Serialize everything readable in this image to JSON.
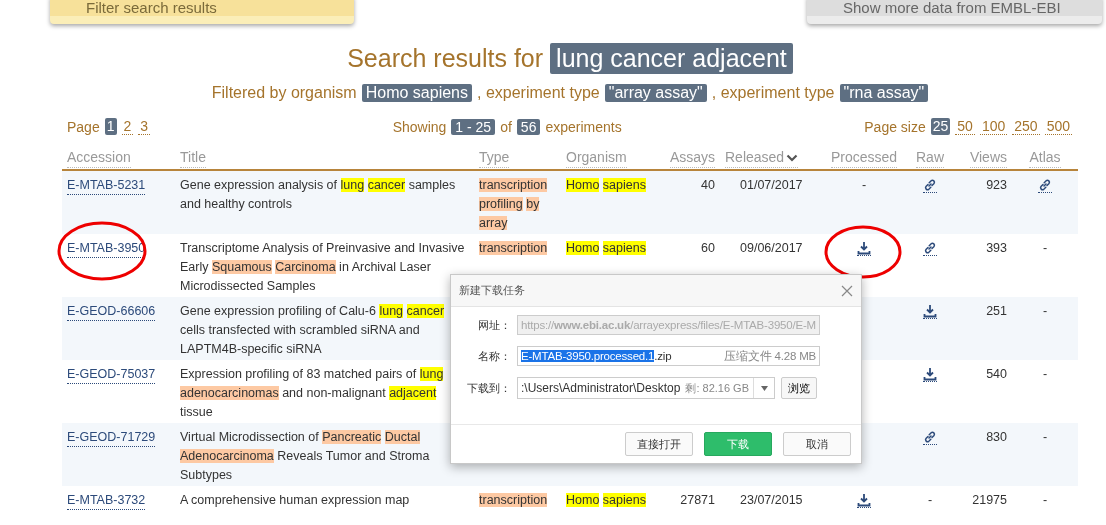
{
  "top_panels": [
    {
      "kind": "filter",
      "label": "Filter search results"
    },
    {
      "kind": "more",
      "label": "Show more data from EMBL-EBI"
    }
  ],
  "heading": {
    "prefix": "Search results for",
    "query": "lung cancer adjacent"
  },
  "filter_line": [
    {
      "text": "Filtered by organism",
      "tag": false
    },
    {
      "text": "Homo sapiens",
      "tag": true
    },
    {
      "text": ", experiment type",
      "tag": false
    },
    {
      "text": "\"array assay\"",
      "tag": true
    },
    {
      "text": ", experiment type",
      "tag": false
    },
    {
      "text": "\"rna assay\"",
      "tag": true
    }
  ],
  "pager": {
    "label": "Page",
    "pages": [
      {
        "label": "1",
        "selected": true
      },
      {
        "label": "2",
        "selected": false
      },
      {
        "label": "3",
        "selected": false
      }
    ]
  },
  "showing": [
    {
      "text": "Showing",
      "tag": false
    },
    {
      "text": "1 - 25",
      "tag": true
    },
    {
      "text": "of",
      "tag": false
    },
    {
      "text": "56",
      "tag": true
    },
    {
      "text": "experiments",
      "tag": false
    }
  ],
  "page_size": {
    "label": "Page size",
    "options": [
      {
        "label": "25",
        "selected": true
      },
      {
        "label": "50",
        "selected": false
      },
      {
        "label": "100",
        "selected": false
      },
      {
        "label": "250",
        "selected": false
      },
      {
        "label": "500",
        "selected": false
      }
    ]
  },
  "table": {
    "columns": [
      {
        "label": "Accession",
        "sorted": false
      },
      {
        "label": "Title",
        "sorted": false
      },
      {
        "label": "Type",
        "sorted": false
      },
      {
        "label": "Organism",
        "sorted": false
      },
      {
        "label": "Assays",
        "sorted": false
      },
      {
        "label": "Released",
        "sorted": true
      },
      {
        "label": "Processed",
        "sorted": false
      },
      {
        "label": "Raw",
        "sorted": false
      },
      {
        "label": "Views",
        "sorted": false
      },
      {
        "label": "Atlas",
        "sorted": false
      }
    ],
    "rows": [
      {
        "accession": "E-MTAB-5231",
        "title": [
          {
            "text": "Gene expression analysis of "
          },
          {
            "text": "lung cancer",
            "color": "#ffff00"
          },
          {
            "text": " samples and healthy controls"
          }
        ],
        "type": [
          {
            "text": "transcription profiling by array",
            "color": "#fdc9a3"
          }
        ],
        "organism": [
          {
            "text": "Homo sapiens",
            "color": "#ffff00"
          }
        ],
        "assays": "40",
        "released": "01/07/2017",
        "processed": {
          "kind": "dash",
          "text": "-"
        },
        "raw": {
          "kind": "link"
        },
        "views": "923",
        "atlas": {
          "kind": "link"
        }
      },
      {
        "accession": "E-MTAB-3950",
        "circled": true,
        "title": [
          {
            "text": "Transcriptome Analysis of Preinvasive and Invasive Early "
          },
          {
            "text": "Squamous Carcinoma",
            "color": "#fdc9a3"
          },
          {
            "text": " in Archival Laser Microdissected Samples"
          }
        ],
        "type": [
          {
            "text": "transcription",
            "color": "#fdc9a3"
          }
        ],
        "organism": [
          {
            "text": "Homo sapiens",
            "color": "#ffff00"
          }
        ],
        "assays": "60",
        "released": "09/06/2017",
        "processed": {
          "kind": "download",
          "circled": true
        },
        "raw": {
          "kind": "link"
        },
        "views": "393",
        "atlas": {
          "kind": "dash",
          "text": "-"
        }
      },
      {
        "accession": "E-GEOD-66606",
        "title": [
          {
            "text": "Gene expression profiling of Calu-6 "
          },
          {
            "text": "lung cancer",
            "color": "#ffff00"
          },
          {
            "text": " cells transfected with scrambled siRNA and LAPTM4B-specific siRNA"
          }
        ],
        "raw": {
          "kind": "download"
        },
        "views": "251",
        "atlas": {
          "kind": "dash",
          "text": "-"
        }
      },
      {
        "accession": "E-GEOD-75037",
        "title": [
          {
            "text": "Expression profiling of 83 matched pairs of "
          },
          {
            "text": "lung",
            "color": "#ffff00"
          },
          {
            "text": "adenocarcinomas",
            "color": "#fdc9a3"
          },
          {
            "text": " and non-malignant "
          },
          {
            "text": "adjacent",
            "color": "#ffff00"
          },
          {
            "text": " tissue"
          }
        ],
        "raw": {
          "kind": "download"
        },
        "views": "540",
        "atlas": {
          "kind": "dash",
          "text": "-"
        }
      },
      {
        "accession": "E-GEOD-71729",
        "title": [
          {
            "text": "Virtual Microdissection of "
          },
          {
            "text": "Pancreatic Ductal Adenocarcinoma",
            "color": "#fdc9a3"
          },
          {
            "text": " Reveals Tumor and Stroma Subtypes"
          }
        ],
        "raw": {
          "kind": "link"
        },
        "views": "830",
        "atlas": {
          "kind": "dash",
          "text": "-"
        }
      },
      {
        "accession": "E-MTAB-3732",
        "title": [
          {
            "text": "A comprehensive human expression map"
          }
        ],
        "type": [
          {
            "text": "transcription",
            "color": "#fdc9a3"
          }
        ],
        "organism": [
          {
            "text": "Homo sapiens",
            "color": "#ffff00"
          }
        ],
        "assays": "27871",
        "released": "23/07/2015",
        "processed": {
          "kind": "download"
        },
        "raw": {
          "kind": "dash",
          "text": "-"
        },
        "views": "21975",
        "atlas": {
          "kind": "dash",
          "text": "-"
        }
      }
    ]
  },
  "dialog": {
    "title": "新建下载任务",
    "url": {
      "label": "网址：",
      "value": "https://**www.ebi.ac.uk**/arrayexpress/files/E-MTAB-3950/E-M",
      "disabled": true
    },
    "name": {
      "label": "名称：",
      "value_parts": [
        {
          "text": "E-MTAB-3950.processed.1",
          "selected": true
        },
        {
          "text": ".zip",
          "selected": false
        }
      ],
      "info": "压缩文件 4.28 MB"
    },
    "save_to": {
      "label": "下载到：",
      "value": ":\\Users\\Administrator\\Desktop",
      "free": "剩: 82.16 GB",
      "browse": "浏览"
    },
    "buttons": [
      {
        "label": "直接打开",
        "kind": "secondary"
      },
      {
        "label": "下载",
        "kind": "primary"
      },
      {
        "label": "取消",
        "kind": "secondary"
      }
    ]
  }
}
